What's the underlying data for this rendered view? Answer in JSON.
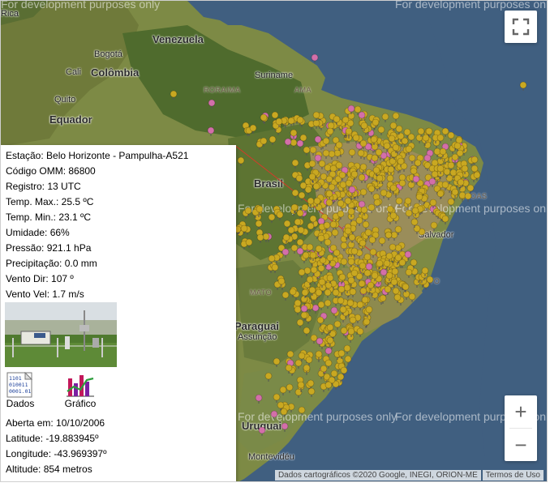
{
  "map": {
    "labels": {
      "countries": [
        "Venezuela",
        "Colômbia",
        "Equador",
        "Brasil",
        "Paraguai",
        "Uruguai"
      ],
      "cities": [
        "Rica",
        "Bogotá",
        "Cali",
        "Quito",
        "Suriname",
        "Assunção",
        "Montevidéu"
      ],
      "regions": [
        "RORAIMA",
        "AMA",
        "MATO",
        "AGOAS",
        "ESTO",
        "Salvador"
      ],
      "watermark": "For development purposes only"
    },
    "attribution": "Dados cartográficos ©2020 Google, INEGI, ORION-ME",
    "terms": "Termos de Uso",
    "colors": {
      "ocean": "#3f5f80",
      "marker_yellow": "#c9a821",
      "marker_pink": "#d36fa9"
    },
    "icons": {
      "fullscreen": "fullscreen-icon",
      "zoom_in": "plus-icon",
      "zoom_out": "minus-icon",
      "marker": "map-pin-icon"
    }
  },
  "controls": {
    "zoom_in": "+",
    "zoom_out": "−"
  },
  "info": {
    "station": "Estação: Belo Horizonte - Pampulha-A521",
    "omm": "Código OMM: 86800",
    "registro": "Registro: 13 UTC",
    "tmax": "Temp. Max.: 25.5 ºC",
    "tmin": "Temp. Min.: 23.1 ºC",
    "umidade": "Umidade: 66%",
    "pressao": "Pressão: 921.1 hPa",
    "precip": "Precipitação: 0.0 mm",
    "vento_dir": "Vento Dir: 107 º",
    "vento_vel": "Vento Vel: 1.7 m/s",
    "dados": "Dados",
    "grafico": "Gráfico",
    "aberta": "Aberta em: 10/10/2006",
    "latitude": "Latitude: -19.883945º",
    "longitude": "Longitude: -43.969397º",
    "altitude": "Altitude: 854 metros"
  }
}
